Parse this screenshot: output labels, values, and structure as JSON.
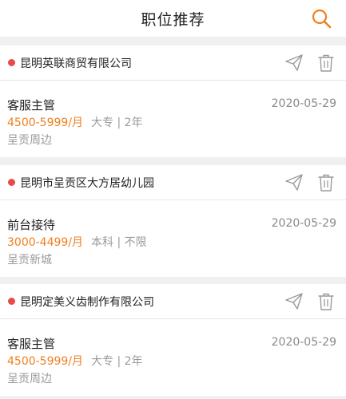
{
  "header": {
    "title": "职位推荐",
    "search_icon": "search-icon"
  },
  "colors": {
    "accent": "#f07e1d",
    "dot": "#e84a4a",
    "icon_gray": "#9a9a9a"
  },
  "jobs": [
    {
      "company": "昆明英联商贸有限公司",
      "title": "客服主管",
      "date": "2020-05-29",
      "salary": "4500-5999/月",
      "requirements": "大专 | 2年",
      "location": "呈贡周边"
    },
    {
      "company": "昆明市呈贡区大方居幼儿园",
      "title": "前台接待",
      "date": "2020-05-29",
      "salary": "3000-4499/月",
      "requirements": "本科 | 不限",
      "location": "呈贡新城"
    },
    {
      "company": "昆明定美义齿制作有限公司",
      "title": "客服主管",
      "date": "2020-05-29",
      "salary": "4500-5999/月",
      "requirements": "大专 | 2年",
      "location": "呈贡周边"
    }
  ]
}
